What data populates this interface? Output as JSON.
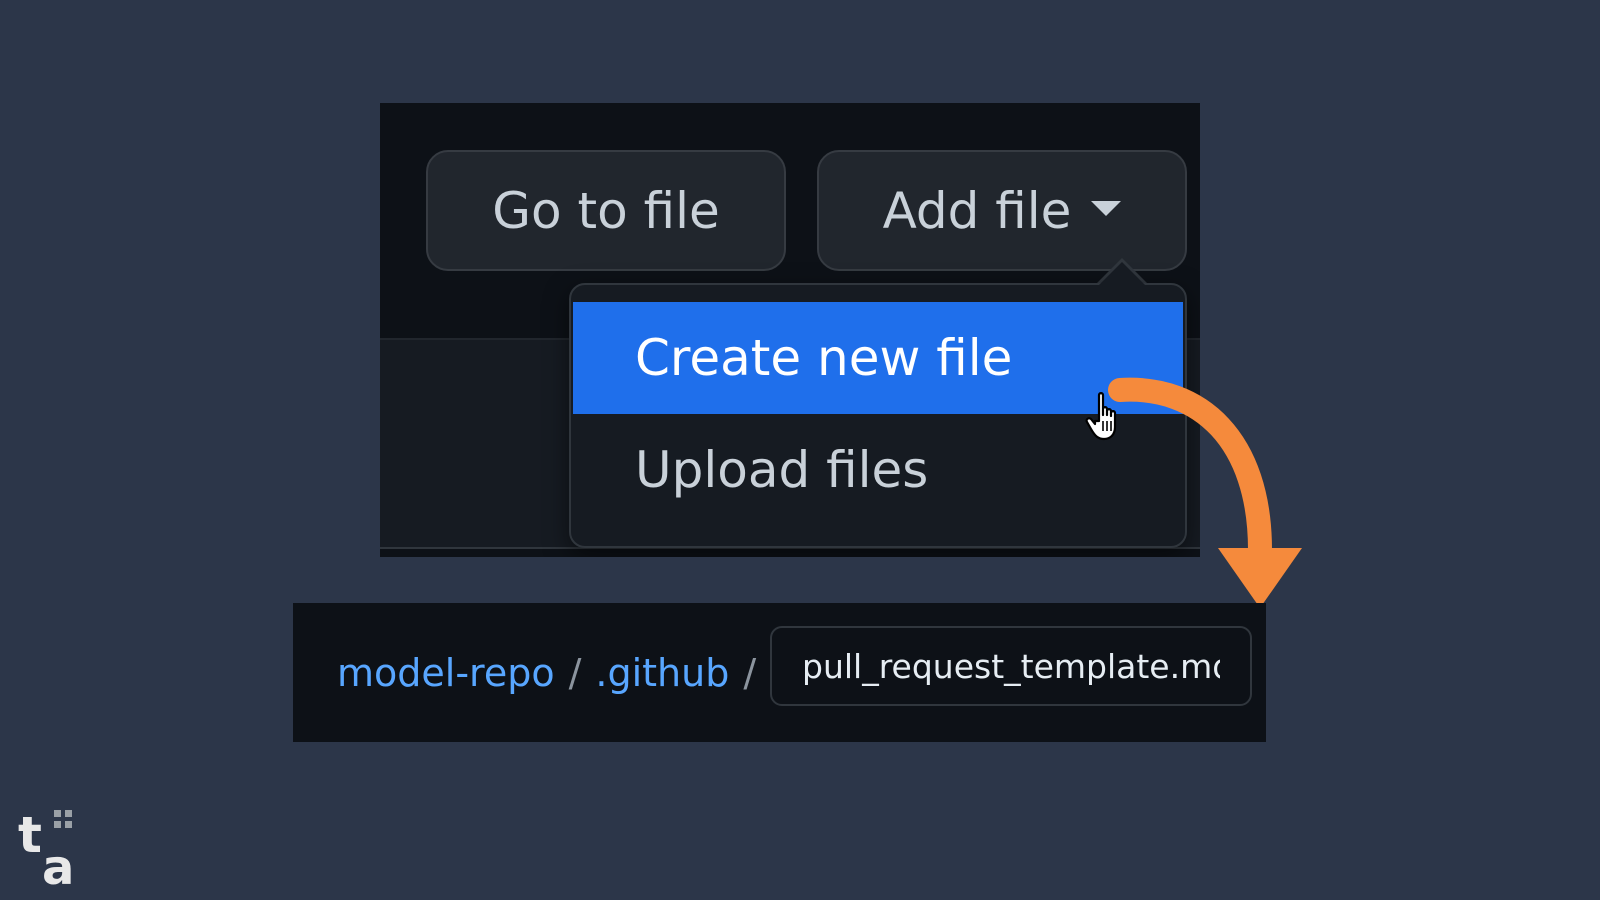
{
  "toolbar": {
    "go_to_file_label": "Go to file",
    "add_file_label": "Add file"
  },
  "dropdown": {
    "items": [
      {
        "label": "Create new file",
        "state": "highlighted"
      },
      {
        "label": "Upload files"
      }
    ]
  },
  "breadcrumb": {
    "repo": "model-repo",
    "separator": "/",
    "folder": ".github",
    "filename_value": "pull_request_template.md"
  },
  "logo": {
    "text": "ta"
  },
  "colors": {
    "background": "#2c3649",
    "panel": "#0d1117",
    "button": "#21262d",
    "highlight": "#1f6feb",
    "link": "#58a6ff",
    "annotation_arrow": "#f58a3c"
  },
  "icons": {
    "cursor": "hand-pointer-icon",
    "caret": "caret-down-icon",
    "annotation": "curved-arrow-icon"
  }
}
